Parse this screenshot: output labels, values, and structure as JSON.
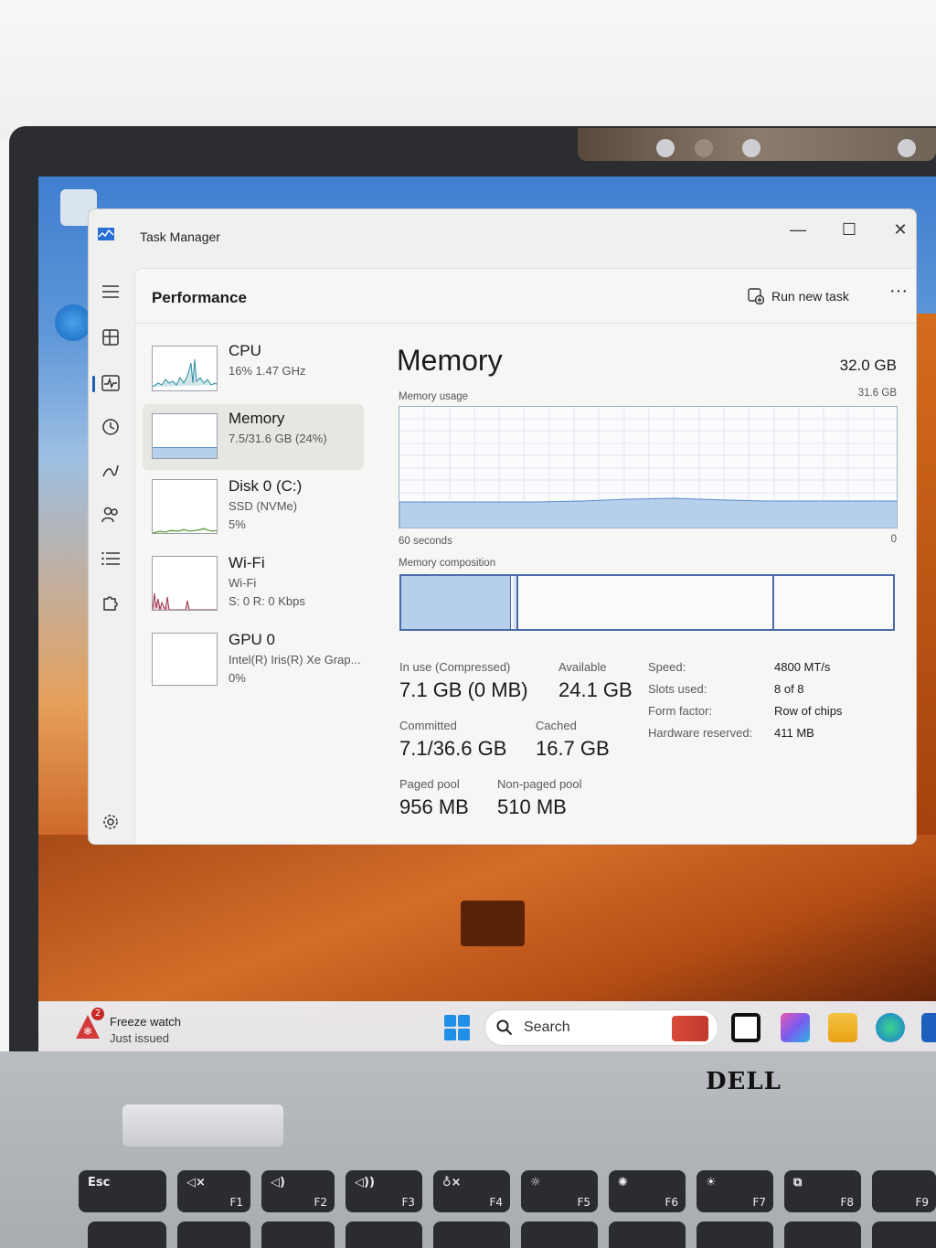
{
  "window": {
    "title": "Task Manager",
    "minimize": "—",
    "maximize": "☐",
    "close": "✕"
  },
  "header": {
    "page_title": "Performance",
    "run_new_task": "Run new task",
    "more": "···"
  },
  "resources": [
    {
      "name": "CPU",
      "line1": "16%  1.47 GHz",
      "line2": ""
    },
    {
      "name": "Memory",
      "line1": "7.5/31.6 GB (24%)",
      "line2": ""
    },
    {
      "name": "Disk 0 (C:)",
      "line1": "SSD (NVMe)",
      "line2": "5%"
    },
    {
      "name": "Wi-Fi",
      "line1": "Wi-Fi",
      "line2": "S: 0  R: 0 Kbps"
    },
    {
      "name": "GPU 0",
      "line1": "Intel(R) Iris(R) Xe Grap...",
      "line2": "0%"
    }
  ],
  "memory": {
    "title": "Memory",
    "total": "32.0 GB",
    "usage_label": "Memory usage",
    "usage_max": "31.6 GB",
    "time_label": "60 seconds",
    "time_min": "0",
    "composition_label": "Memory composition",
    "in_use_label": "In use (Compressed)",
    "in_use_value": "7.1 GB (0 MB)",
    "available_label": "Available",
    "available_value": "24.1 GB",
    "committed_label": "Committed",
    "committed_value": "7.1/36.6 GB",
    "cached_label": "Cached",
    "cached_value": "16.7 GB",
    "paged_label": "Paged pool",
    "paged_value": "956 MB",
    "nonpaged_label": "Non-paged pool",
    "nonpaged_value": "510 MB",
    "speed_label": "Speed:",
    "speed_value": "4800 MT/s",
    "slots_label": "Slots used:",
    "slots_value": "8 of 8",
    "form_label": "Form factor:",
    "form_value": "Row of chips",
    "hwres_label": "Hardware reserved:",
    "hwres_value": "411 MB"
  },
  "taskbar": {
    "widget_title": "Freeze watch",
    "widget_sub": "Just issued",
    "widget_badge": "2",
    "search_placeholder": "Search"
  },
  "keyboard": {
    "brand": "DELL",
    "esc": "Esc",
    "keys": [
      "F1",
      "F2",
      "F3",
      "F4",
      "F5",
      "F6",
      "F7",
      "F8",
      "F9"
    ]
  },
  "colors": {
    "accent": "#1a5fb4",
    "memory_fill": "#b6d0ec",
    "memory_line": "#5b8cc8",
    "cpu_line": "#2e8ba0",
    "disk_line": "#4c8a2e",
    "wifi_line": "#a0304a"
  }
}
